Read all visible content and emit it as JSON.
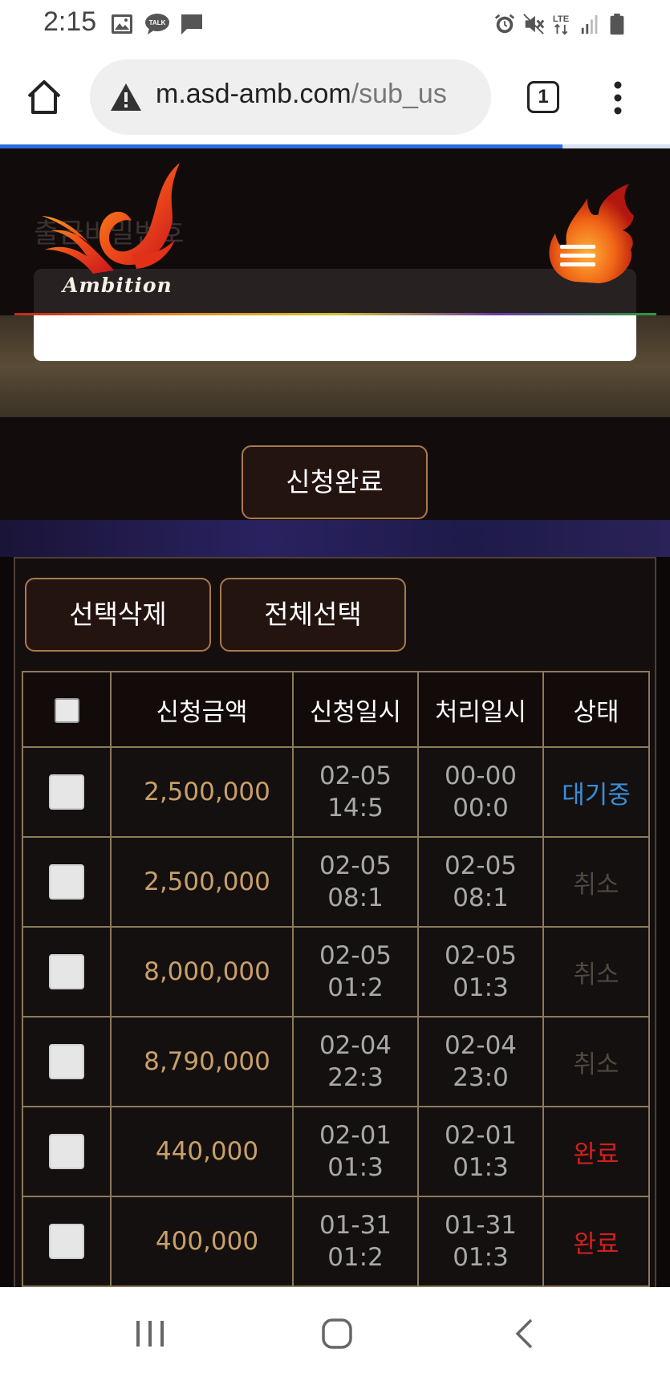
{
  "status_bar": {
    "time": "2:15",
    "left_icons": [
      "image-icon",
      "talk-icon",
      "message-icon"
    ],
    "right_icons": [
      "alarm-icon",
      "mute-icon",
      "lte-icon",
      "signal-icon",
      "battery-icon"
    ],
    "talk_badge": "TALK",
    "lte_label": "LTE"
  },
  "browser": {
    "url_host": "m.asd-amb.com",
    "url_path": "/sub_us",
    "tab_count": "1",
    "progress": 0.84
  },
  "header": {
    "logo_text": "Ambition",
    "background_label": "출금비밀번호"
  },
  "submit_button": "신청완료",
  "list_actions": {
    "delete_selected": "선택삭제",
    "select_all": "전체선택"
  },
  "table": {
    "headers": [
      "신청금액",
      "신청일시",
      "처리일시",
      "상태"
    ],
    "rows": [
      {
        "amount": "2,500,000",
        "requested": "02-05 14:5",
        "processed": "00-00 00:0",
        "status": "대기중",
        "status_color": "#3a8fd8"
      },
      {
        "amount": "2,500,000",
        "requested": "02-05 08:1",
        "processed": "02-05 08:1",
        "status": "취소",
        "status_color": "#4f4840"
      },
      {
        "amount": "8,000,000",
        "requested": "02-05 01:2",
        "processed": "02-05 01:3",
        "status": "취소",
        "status_color": "#4f4840"
      },
      {
        "amount": "8,790,000",
        "requested": "02-04 22:3",
        "processed": "02-04 23:0",
        "status": "취소",
        "status_color": "#4f4840"
      },
      {
        "amount": "440,000",
        "requested": "02-01 01:3",
        "processed": "02-01 01:3",
        "status": "완료",
        "status_color": "#d21f1f"
      },
      {
        "amount": "400,000",
        "requested": "01-31 01:2",
        "processed": "01-31 01:3",
        "status": "완료",
        "status_color": "#d21f1f"
      }
    ]
  },
  "nav_bar": {
    "buttons": [
      "recent-apps-icon",
      "home-icon",
      "back-icon"
    ]
  }
}
